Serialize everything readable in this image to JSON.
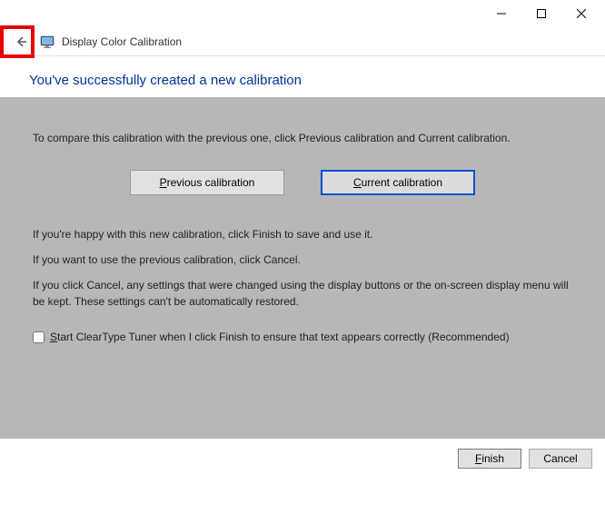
{
  "window": {
    "title": "Display Color Calibration"
  },
  "heading": "You've successfully created a new calibration",
  "body": {
    "compareText": "To compare this calibration with the previous one, click Previous calibration and Current calibration.",
    "previousBtn": "Previous calibration",
    "currentBtn": "Current calibration",
    "p1": "If you're happy with this new calibration, click Finish to save and use it.",
    "p2": "If you want to use the previous calibration, click Cancel.",
    "p3": "If you click Cancel, any settings that were changed using the display buttons or the on-screen display menu will be kept. These settings can't be automatically restored.",
    "checkboxLabel": "Start ClearType Tuner when I click Finish to ensure that text appears correctly (Recommended)"
  },
  "footer": {
    "finish": "Finish",
    "cancel": "Cancel"
  }
}
